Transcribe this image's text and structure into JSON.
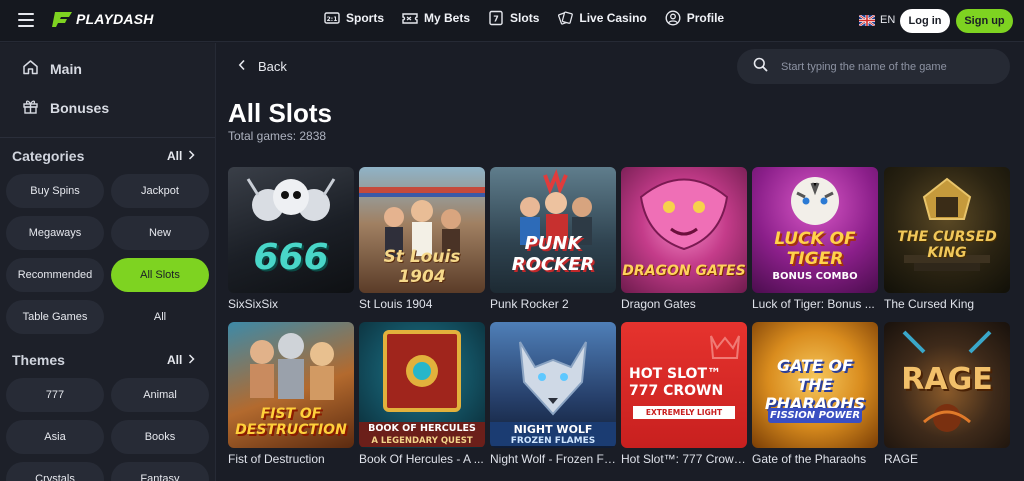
{
  "header": {
    "brand": "PLAYDASH",
    "nav": [
      {
        "label": "Sports",
        "icon": "sports-icon"
      },
      {
        "label": "My Bets",
        "icon": "ticket-icon"
      },
      {
        "label": "Slots",
        "icon": "slots-icon"
      },
      {
        "label": "Live Casino",
        "icon": "cards-icon"
      },
      {
        "label": "Profile",
        "icon": "user-icon"
      }
    ],
    "language": "EN",
    "login_label": "Log in",
    "signup_label": "Sign up",
    "accent": "#7ed321"
  },
  "sidebar": {
    "links": [
      {
        "label": "Main",
        "icon": "home-icon"
      },
      {
        "label": "Bonuses",
        "icon": "gift-icon"
      }
    ],
    "categories": {
      "title": "Categories",
      "all_label": "All",
      "items": [
        "Buy Spins",
        "Jackpot",
        "Megaways",
        "New",
        "Recommended",
        "All Slots",
        "Table Games",
        "All"
      ],
      "active": "All Slots"
    },
    "themes": {
      "title": "Themes",
      "all_label": "All",
      "items": [
        "777",
        "Animal",
        "Asia",
        "Books",
        "Crystals",
        "Fantasy"
      ]
    }
  },
  "main": {
    "back_label": "Back",
    "search_placeholder": "Start typing the name of the game",
    "title": "All Slots",
    "total": "Total games: 2838",
    "games": [
      {
        "name": "SixSixSix",
        "art": "666"
      },
      {
        "name": "St Louis 1904",
        "art": "St Louis 1904"
      },
      {
        "name": "Punk Rocker 2",
        "art": "PUNK ROCKER"
      },
      {
        "name": "Dragon Gates",
        "art": "DRAGON GATES"
      },
      {
        "name": "Luck of Tiger: Bonus ...",
        "art": "LUCK OF TIGER",
        "art_sub": "BONUS COMBO"
      },
      {
        "name": "The Cursed King",
        "art": "THE CURSED KING"
      },
      {
        "name": "Fist of Destruction",
        "art": "FIST OF DESTRUCTION"
      },
      {
        "name": "Book Of Hercules - A ...",
        "art": "BOOK OF HERCULES",
        "art_sub": "A LEGENDARY QUEST"
      },
      {
        "name": "Night Wolf - Frozen Fl...",
        "art": "NIGHT WOLF",
        "art_sub": "FROZEN FLAMES"
      },
      {
        "name": "Hot Slot™: 777 Crown ...",
        "art": "HOT SLOT™ 777 CROWN",
        "art_sub": "EXTREMELY LIGHT"
      },
      {
        "name": "Gate of the Pharaohs",
        "art": "GATE OF THE PHARAOHS",
        "art_sub": "FISSION POWER"
      },
      {
        "name": "RAGE",
        "art": "RAGE"
      }
    ]
  }
}
